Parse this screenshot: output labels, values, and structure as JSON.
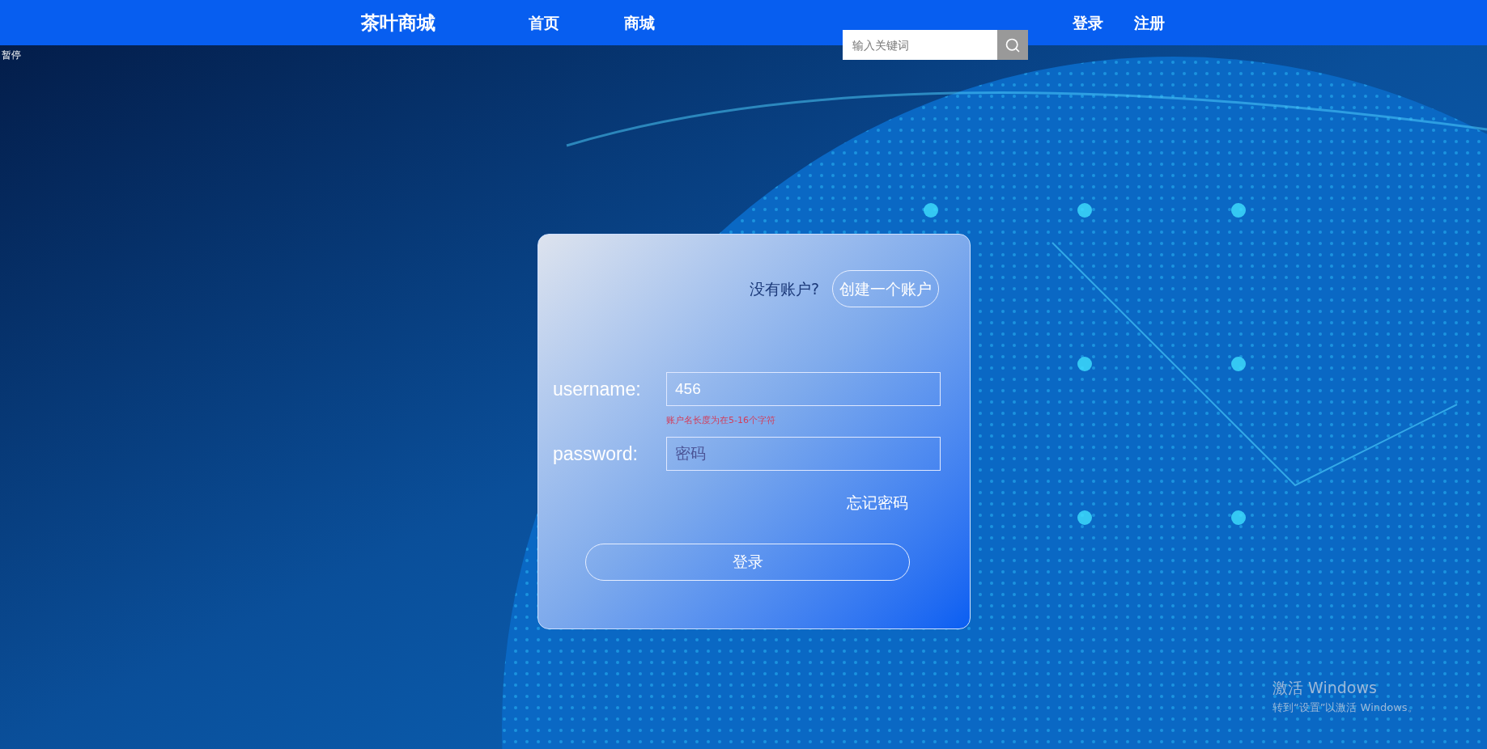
{
  "nav": {
    "logo": "茶叶商城",
    "links": [
      {
        "label": "首页"
      },
      {
        "label": "商城"
      }
    ],
    "search": {
      "placeholder": "输入关键词"
    },
    "auth_links": [
      {
        "label": "登录"
      },
      {
        "label": "注册"
      }
    ]
  },
  "status_label": "暂停",
  "login": {
    "prompt": "没有账户?",
    "create_button": "创建一个账户",
    "fields": [
      {
        "label": "username:",
        "value": "456",
        "error": "账户名长度为在5-16个字符"
      },
      {
        "label": "password:",
        "placeholder": "密码"
      }
    ],
    "forgot_link": "忘记密码",
    "submit": "登录"
  },
  "os_overlay": {
    "title": "激活 Windows",
    "subtitle": "转到“设置”以激活 Windows。"
  }
}
